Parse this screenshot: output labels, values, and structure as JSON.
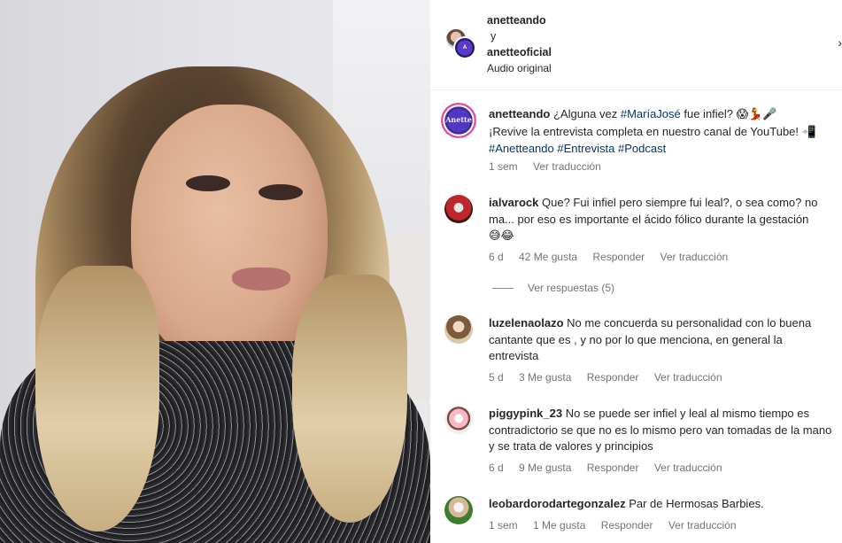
{
  "post": {
    "collab_user_1": "anetteando",
    "connector": "y",
    "collab_user_2": "anetteoficial",
    "audio": "Audio original",
    "more_icon": "chevron-right-icon"
  },
  "caption": {
    "user": "anetteando",
    "text_1": "¿Alguna vez ",
    "tag_1": "#MaríaJosé",
    "text_2": " fue infiel? ",
    "emojis_1": "😱💃🎤",
    "text_3": "¡Revive la entrevista completa en nuestro canal de YouTube! ",
    "emojis_2": "📲",
    "tag_2": "#Anetteando",
    "tag_3": "#Entrevista",
    "tag_4": "#Podcast",
    "time": "1 sem",
    "translate": "Ver traducción",
    "avatar_text": "Anette ando"
  },
  "comments": [
    {
      "user": "ialvarock",
      "text": "Que? Fui infiel pero siempre fui leal?, o sea como? no ma... por eso es importante el ácido fólico durante la gestación",
      "emojis": "😅😂",
      "time": "6 d",
      "likes": "42 Me gusta",
      "reply": "Responder",
      "translate": "Ver traducción",
      "replies_label": "Ver respuestas (5)"
    },
    {
      "user": "luzelenaolazo",
      "text": "No me concuerda su personalidad con lo buena cantante que es , y no por lo que menciona, en general la entrevista",
      "time": "5 d",
      "likes": "3 Me gusta",
      "reply": "Responder",
      "translate": "Ver traducción"
    },
    {
      "user": "piggypink_23",
      "text": "No se puede ser infiel y leal al mismo tiempo es contradictorio se que no es lo mismo pero van tomadas de la mano y se trata de valores y principios",
      "time": "6 d",
      "likes": "9 Me gusta",
      "reply": "Responder",
      "translate": "Ver traducción"
    },
    {
      "user": "leobardorodartegonzalez",
      "text": "Par de Hermosas Barbies.",
      "time": "1 sem",
      "likes": "1 Me gusta",
      "reply": "Responder",
      "translate": "Ver traducción"
    }
  ],
  "colors": {
    "link": "#00376b",
    "meta": "#737373",
    "text": "#262626"
  }
}
